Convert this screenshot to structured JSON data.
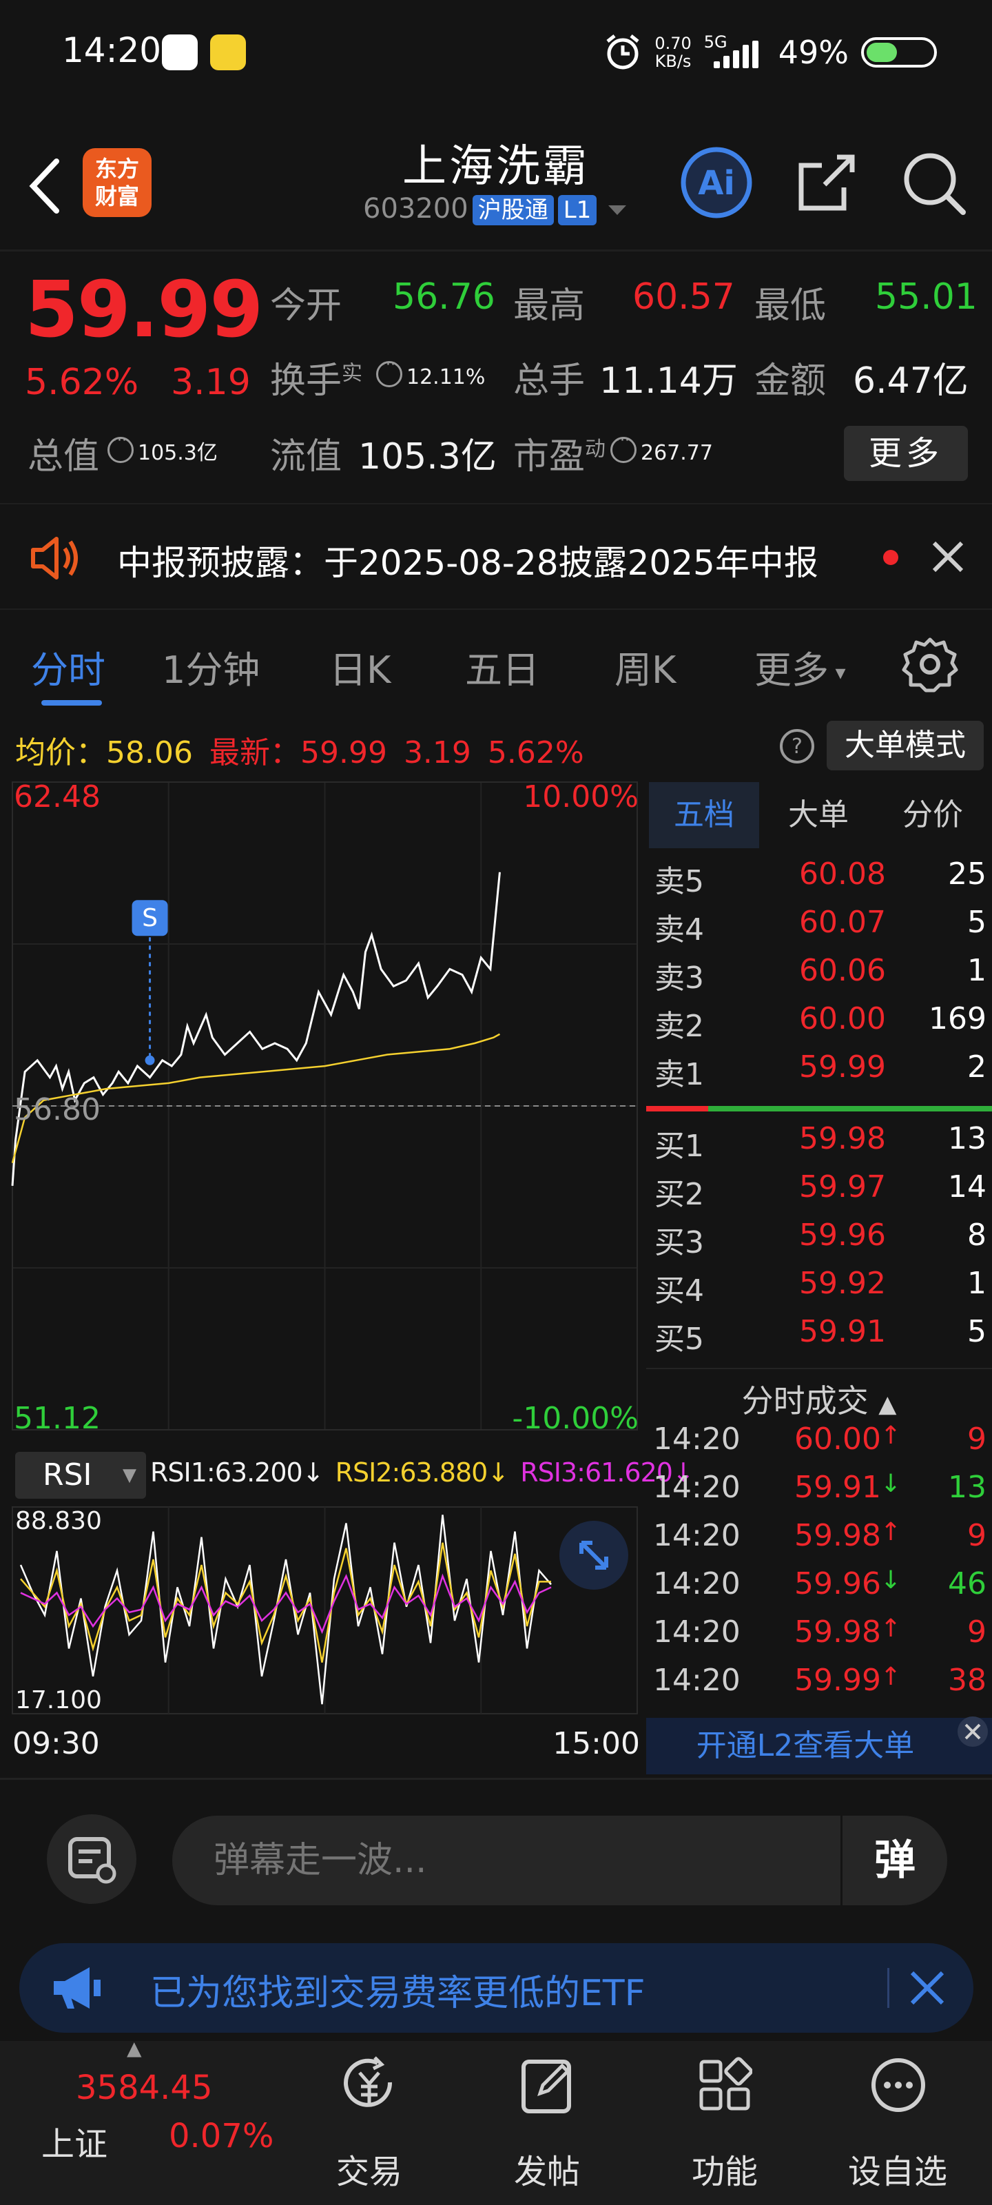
{
  "status_bar": {
    "time": "14:20",
    "net_speed_value": "0.70",
    "net_speed_unit": "KB/s",
    "network": "5G",
    "battery": "49%",
    "battery_level": 0.49
  },
  "header": {
    "logo_line1": "东方",
    "logo_line2": "财富",
    "stock_name": "上海洗霸",
    "stock_code": "603200",
    "tag_connect": "沪股通",
    "tag_level": "L1",
    "ai_label": "Ai"
  },
  "quote": {
    "last_price": "59.99",
    "change_pct": "5.62%",
    "change_amt": "3.19",
    "open_label": "今开",
    "open_value": "56.76",
    "high_label": "最高",
    "high_value": "60.57",
    "low_label": "最低",
    "low_value": "55.01",
    "turnover_label": "换手",
    "turnover_sup": "实",
    "turnover_value": "12.11%",
    "volume_label": "总手",
    "volume_value": "11.14万",
    "amount_label": "金额",
    "amount_value": "6.47亿",
    "mktcap_label": "总值",
    "mktcap_value": "105.3亿",
    "float_label": "流值",
    "float_value": "105.3亿",
    "pe_label": "市盈",
    "pe_sup": "动",
    "pe_value": "267.77",
    "more_button": "更多"
  },
  "notice": {
    "text": "中报预披露：于2025-08-28披露2025年中报"
  },
  "tabs": [
    "分时",
    "1分钟",
    "日K",
    "五日",
    "周K",
    "更多"
  ],
  "info_line": {
    "avg_label": "均价：",
    "avg_value": "58.06",
    "latest_label": "最新：",
    "latest_value": "59.99",
    "latest_change": "3.19",
    "latest_pct": "5.62%",
    "big_order_button": "大单模式"
  },
  "chart_data": [
    {
      "type": "line",
      "y_max_label": "62.48",
      "y_min_label": "51.12",
      "pct_max_label": "10.00%",
      "pct_min_label": "-10.00%",
      "prev_close_label": "56.80",
      "ylim": [
        51.12,
        62.48
      ],
      "prev_close": 56.8,
      "x_start_label": "09:30",
      "x_end_label": "15:00",
      "marker_label": "S",
      "series": [
        {
          "role": "price",
          "color": "#ffffff",
          "values": [
            55.4,
            56.2,
            57.4,
            57.6,
            57.3,
            57.5,
            57.1,
            57.4,
            56.9,
            57.2,
            57.3,
            57.0,
            57.2,
            57.4,
            57.2,
            57.5,
            57.3,
            57.6,
            57.5,
            57.7,
            58.2,
            57.9,
            58.4,
            58.0,
            57.7,
            57.9,
            58.1,
            57.8,
            57.9,
            57.8,
            57.6,
            57.9,
            58.8,
            58.4,
            59.1,
            58.8,
            58.5,
            59.5,
            59.8,
            59.2,
            58.9,
            59.0,
            59.3,
            58.7,
            58.9,
            59.2,
            59.1,
            58.8,
            59.4,
            59.2,
            60.9
          ],
          "x_fraction": [
            0.0,
            0.005,
            0.02,
            0.04,
            0.06,
            0.07,
            0.08,
            0.09,
            0.1,
            0.115,
            0.13,
            0.145,
            0.16,
            0.17,
            0.185,
            0.2,
            0.22,
            0.24,
            0.255,
            0.27,
            0.28,
            0.29,
            0.31,
            0.32,
            0.34,
            0.36,
            0.38,
            0.4,
            0.42,
            0.44,
            0.455,
            0.47,
            0.49,
            0.51,
            0.53,
            0.545,
            0.555,
            0.565,
            0.575,
            0.59,
            0.61,
            0.63,
            0.65,
            0.665,
            0.68,
            0.7,
            0.72,
            0.735,
            0.75,
            0.765,
            0.78
          ]
        },
        {
          "role": "average",
          "color": "#f5d12f",
          "values": [
            55.8,
            56.6,
            56.9,
            57.0,
            57.1,
            57.15,
            57.2,
            57.3,
            57.35,
            57.4,
            57.45,
            57.5,
            57.6,
            57.7,
            57.75,
            57.8,
            57.9,
            58.0,
            58.06
          ],
          "x_fraction": [
            0.0,
            0.02,
            0.05,
            0.1,
            0.15,
            0.2,
            0.25,
            0.3,
            0.35,
            0.4,
            0.45,
            0.5,
            0.55,
            0.6,
            0.65,
            0.7,
            0.74,
            0.77,
            0.78
          ]
        }
      ]
    },
    {
      "type": "line",
      "indicator": "RSI",
      "top_label": "88.830",
      "bottom_label": "17.100",
      "ylim": [
        17.1,
        88.83
      ],
      "legend": [
        {
          "name": "RSI1:63.200",
          "color": "#ffffff",
          "arrow": "↓"
        },
        {
          "name": "RSI2:63.880",
          "color": "#f5d12f",
          "arrow": "↓"
        },
        {
          "name": "RSI3:61.620",
          "color": "#e032e0",
          "arrow": "↓"
        }
      ],
      "series": [
        {
          "color": "#ffffff",
          "values": [
            70,
            60,
            52,
            75,
            40,
            58,
            30,
            55,
            68,
            45,
            50,
            82,
            35,
            62,
            48,
            80,
            40,
            65,
            55,
            70,
            30,
            50,
            72,
            45,
            60,
            20,
            65,
            85,
            48,
            62,
            38,
            78,
            55,
            70,
            42,
            88,
            50,
            65,
            35,
            75,
            52,
            82,
            40,
            68,
            63
          ]
        },
        {
          "color": "#f5d12f",
          "values": [
            65,
            60,
            55,
            68,
            48,
            56,
            40,
            54,
            62,
            50,
            52,
            72,
            44,
            58,
            52,
            70,
            48,
            60,
            56,
            64,
            42,
            52,
            66,
            50,
            58,
            35,
            60,
            76,
            52,
            58,
            46,
            70,
            56,
            64,
            48,
            78,
            54,
            60,
            44,
            68,
            55,
            74,
            48,
            64,
            64
          ]
        },
        {
          "color": "#e032e0",
          "values": [
            60,
            58,
            56,
            60,
            52,
            55,
            48,
            54,
            58,
            53,
            54,
            62,
            50,
            56,
            54,
            62,
            52,
            57,
            55,
            59,
            50,
            54,
            60,
            53,
            56,
            46,
            57,
            66,
            54,
            56,
            51,
            62,
            56,
            59,
            52,
            66,
            55,
            58,
            50,
            62,
            56,
            64,
            53,
            60,
            62
          ]
        }
      ]
    }
  ],
  "order_book": {
    "tabs": [
      "五档",
      "大单",
      "分价"
    ],
    "asks": [
      {
        "label": "卖5",
        "price": "60.08",
        "volume": "25"
      },
      {
        "label": "卖4",
        "price": "60.07",
        "volume": "5"
      },
      {
        "label": "卖3",
        "price": "60.06",
        "volume": "1"
      },
      {
        "label": "卖2",
        "price": "60.00",
        "volume": "169"
      },
      {
        "label": "卖1",
        "price": "59.99",
        "volume": "2"
      }
    ],
    "bids": [
      {
        "label": "买1",
        "price": "59.98",
        "volume": "13"
      },
      {
        "label": "买2",
        "price": "59.97",
        "volume": "14"
      },
      {
        "label": "买3",
        "price": "59.96",
        "volume": "8"
      },
      {
        "label": "买4",
        "price": "59.92",
        "volume": "1"
      },
      {
        "label": "买5",
        "price": "59.91",
        "volume": "5"
      }
    ],
    "ticks_title": "分时成交",
    "ticks": [
      {
        "time": "14:20",
        "price": "60.00",
        "dir": "↑",
        "volume": "9",
        "up": true
      },
      {
        "time": "14:20",
        "price": "59.91",
        "dir": "↓",
        "volume": "13",
        "up": false
      },
      {
        "time": "14:20",
        "price": "59.98",
        "dir": "↑",
        "volume": "9",
        "up": true
      },
      {
        "time": "14:20",
        "price": "59.96",
        "dir": "↓",
        "volume": "46",
        "up": false
      },
      {
        "time": "14:20",
        "price": "59.98",
        "dir": "↑",
        "volume": "9",
        "up": true
      },
      {
        "time": "14:20",
        "price": "59.99",
        "dir": "↑",
        "volume": "38",
        "up": true
      }
    ],
    "l2_button": "开通L2查看大单"
  },
  "rsi_select": "RSI",
  "comment": {
    "placeholder": "弹幕走一波...",
    "danmu_button": "弹"
  },
  "etf_banner": {
    "text": "已为您找到交易费率更低的ETF"
  },
  "bottom_nav": {
    "index_value": "3584.45",
    "index_name": "上证",
    "index_pct": "0.07%",
    "items": [
      "交易",
      "发帖",
      "功能",
      "设自选"
    ]
  },
  "colors": {
    "up": "#f0262b",
    "down": "#2fcf3a",
    "accent": "#3f82e8",
    "avg_line": "#f5d12f",
    "background": "#141414"
  }
}
